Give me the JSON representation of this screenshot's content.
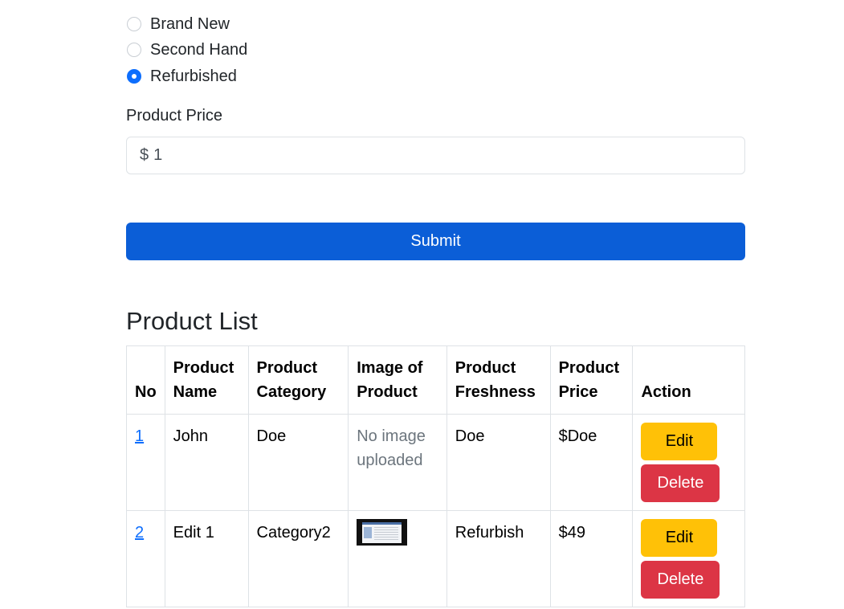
{
  "condition": {
    "options": [
      {
        "label": "Brand New",
        "checked": false
      },
      {
        "label": "Second Hand",
        "checked": false
      },
      {
        "label": "Refurbished",
        "checked": true
      }
    ]
  },
  "price": {
    "label": "Product Price",
    "prefix": "$",
    "value": "1"
  },
  "submit_label": "Submit",
  "product_list": {
    "title": "Product List",
    "headers": {
      "no": "No",
      "name": "Product Name",
      "category": "Product Category",
      "image": "Image of Product",
      "freshness": "Product Freshness",
      "price": "Product Price",
      "action": "Action"
    },
    "rows": [
      {
        "no": "1",
        "name": "John",
        "category": "Doe",
        "image": "No image uploaded",
        "freshness": "Doe",
        "price": "$Doe",
        "edit": "Edit",
        "delete": "Delete"
      },
      {
        "no": "2",
        "name": "Edit 1",
        "category": "Category2",
        "image": "",
        "freshness": "Refurbish",
        "price": "$49",
        "edit": "Edit",
        "delete": "Delete"
      }
    ]
  },
  "colors": {
    "primary": "#0b5ed7",
    "warning": "#ffc107",
    "danger": "#dc3545",
    "link": "#0d6efd"
  }
}
